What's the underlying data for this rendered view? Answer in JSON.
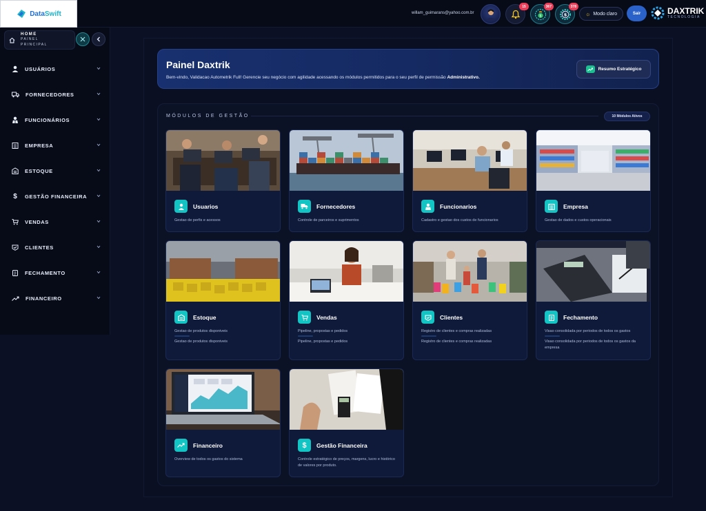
{
  "brand": {
    "name_part1": "Data",
    "name_part2": "Swift"
  },
  "header": {
    "user_email": "willam_guimarans@yahoo.com.br",
    "notifications_count": "15",
    "badge_2": "367",
    "badge_3": "378",
    "theme_label": "Modo claro",
    "exit_label": "Sair",
    "company_name": "DAXTRIK",
    "company_sub": "TECNOLOGIA"
  },
  "sidebar": {
    "home_title": "HOME",
    "home_sub1": "PAINEL",
    "home_sub2": "PRINCIPAL",
    "items": [
      {
        "label": "USUÁRIOS",
        "icon": "user-icon"
      },
      {
        "label": "FORNECEDORES",
        "icon": "truck-icon"
      },
      {
        "label": "FUNCIONÁRIOS",
        "icon": "employee-icon"
      },
      {
        "label": "EMPRESA",
        "icon": "building-icon"
      },
      {
        "label": "ESTOQUE",
        "icon": "warehouse-icon"
      },
      {
        "label": "GESTÃO FINANCEIRA",
        "icon": "dollar-icon"
      },
      {
        "label": "VENDAS",
        "icon": "cart-icon"
      },
      {
        "label": "CLIENTES",
        "icon": "clients-icon"
      },
      {
        "label": "FECHAMENTO",
        "icon": "clipboard-icon"
      },
      {
        "label": "FINANCEIRO",
        "icon": "trend-icon"
      }
    ]
  },
  "hero": {
    "title": "Painel Daxtrik",
    "text": "Bem-vindo, Validacao Autometrik Full! Gerencie seu negócio com agilidade acessando os módulos permitidos para o seu perfil de permissão",
    "role": "Administrativo.",
    "summary_button": "Resumo Estratégico"
  },
  "modules": {
    "title": "MÓDULOS DE GESTÃO",
    "count": "10 Módulos Ativos",
    "cards": [
      {
        "title": "Usuarios",
        "desc": "Gestao de perfis e acessos",
        "desc2": "",
        "icon": "user-icon"
      },
      {
        "title": "Fornecedores",
        "desc": "Controle de parceiros e suprimentos",
        "desc2": "",
        "icon": "truck-icon"
      },
      {
        "title": "Funcionarios",
        "desc": "Cadastro e gestao dos custos de funcionarios",
        "desc2": "",
        "icon": "employee-icon"
      },
      {
        "title": "Empresa",
        "desc": "Gestao de dados e custos operacionais",
        "desc2": "",
        "icon": "building-icon"
      },
      {
        "title": "Estoque",
        "desc": "Gestao de produtos disponiveis",
        "desc2": "Gestao de produtos disponiveis",
        "icon": "warehouse-icon"
      },
      {
        "title": "Vendas",
        "desc": "Pipeline, propostas e pedidos",
        "desc2": "Pipeline, propostas e pedidos",
        "icon": "cart-icon"
      },
      {
        "title": "Clientes",
        "desc": "Registro de clientes e compras realizadas",
        "desc2": "Registro de clientes e compras realizadas",
        "icon": "clients-icon"
      },
      {
        "title": "Fechamento",
        "desc": "Visao consolidada por periodos de todos os gastos",
        "desc2": "Visao consolidada por periodos de todos os gastos da empresa",
        "icon": "clipboard-icon"
      },
      {
        "title": "Financeiro",
        "desc": "Overview de todos os gastos do sistema",
        "desc2": "",
        "icon": "trend-icon"
      },
      {
        "title": "Gestão Financeira",
        "desc": "Controle estratégico de preços, margens, lucro e histórico de valores por produto.",
        "desc2": "",
        "icon": "dollar-icon"
      }
    ]
  },
  "colors": {
    "accent": "#12c4c4",
    "primary": "#2a62c9",
    "badge": "#ef3d58",
    "background": "#0b1024"
  }
}
